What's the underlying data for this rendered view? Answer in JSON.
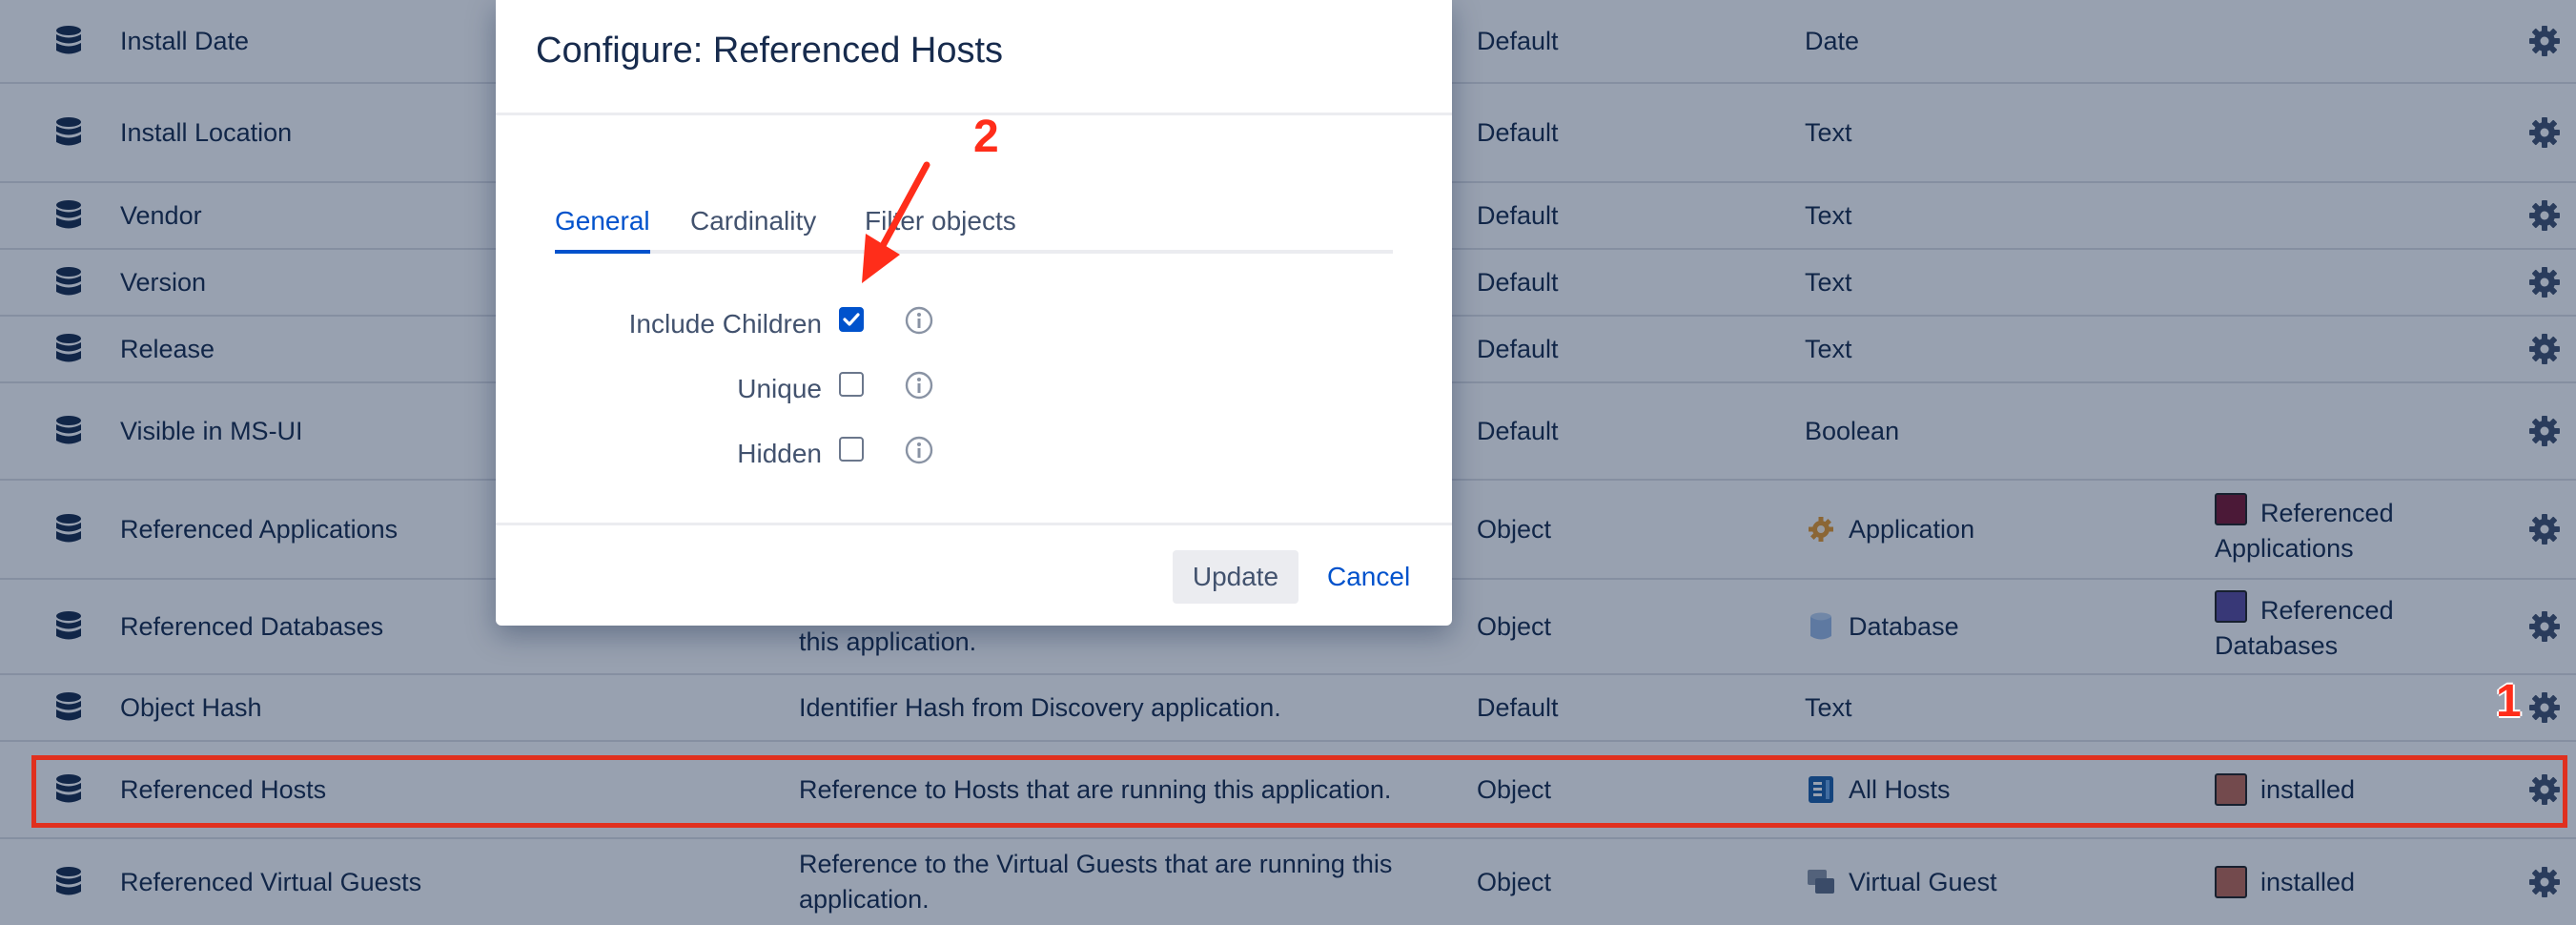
{
  "table": {
    "rows": [
      {
        "name": "Install Date",
        "description": "",
        "kind": "Default",
        "type": "Date",
        "type_icon": "",
        "extra": "",
        "extra_color": ""
      },
      {
        "name": "Install Location",
        "description": "",
        "kind": "Default",
        "type": "Text",
        "type_icon": "",
        "extra": "",
        "extra_color": ""
      },
      {
        "name": "Vendor",
        "description": "",
        "kind": "Default",
        "type": "Text",
        "type_icon": "",
        "extra": "",
        "extra_color": ""
      },
      {
        "name": "Version",
        "description": "",
        "kind": "Default",
        "type": "Text",
        "type_icon": "",
        "extra": "",
        "extra_color": ""
      },
      {
        "name": "Release",
        "description": "",
        "kind": "Default",
        "type": "Text",
        "type_icon": "",
        "extra": "",
        "extra_color": ""
      },
      {
        "name": "Visible in MS-UI",
        "description": "",
        "kind": "Default",
        "type": "Boolean",
        "type_icon": "",
        "extra": "",
        "extra_color": ""
      },
      {
        "name": "Referenced Applications",
        "description": "",
        "kind": "Object",
        "type": "Application",
        "type_icon": "application-gear-icon",
        "extra": "Referenced Applications",
        "extra_color": "#7a1530"
      },
      {
        "name": "Referenced Databases",
        "description": "this application.",
        "kind": "Object",
        "type": "Database",
        "type_icon": "database-cylinder-icon",
        "extra": "Referenced Databases",
        "extra_color": "#5b4a9e"
      },
      {
        "name": "Object Hash",
        "description": "Identifier Hash from Discovery application.",
        "kind": "Default",
        "type": "Text",
        "type_icon": "",
        "extra": "",
        "extra_color": ""
      },
      {
        "name": "Referenced Hosts",
        "description": "Reference to Hosts that are running this application.",
        "kind": "Object",
        "type": "All Hosts",
        "type_icon": "hosts-book-icon",
        "extra": "installed",
        "extra_color": "#c06a55"
      },
      {
        "name": "Referenced Virtual Guests",
        "description": "Reference to the Virtual Guests that are running this application.",
        "kind": "Object",
        "type": "Virtual Guest",
        "type_icon": "virtual-guest-stack-icon",
        "extra": "installed",
        "extra_color": "#c06a55"
      }
    ]
  },
  "dialog": {
    "title": "Configure: Referenced Hosts",
    "tabs": [
      {
        "label": "General",
        "active": true
      },
      {
        "label": "Cardinality",
        "active": false
      },
      {
        "label": "Filter objects",
        "active": false
      }
    ],
    "fields": [
      {
        "label": "Include Children",
        "checked": true
      },
      {
        "label": "Unique",
        "checked": false
      },
      {
        "label": "Hidden",
        "checked": false
      }
    ],
    "update_label": "Update",
    "cancel_label": "Cancel"
  },
  "annotations": {
    "one": "1",
    "two": "2"
  },
  "colors": {
    "highlight": "#e0301e",
    "annotation": "#ff2d1a",
    "link": "#0052cc",
    "overlay": "rgba(9,30,66,0.42)"
  }
}
